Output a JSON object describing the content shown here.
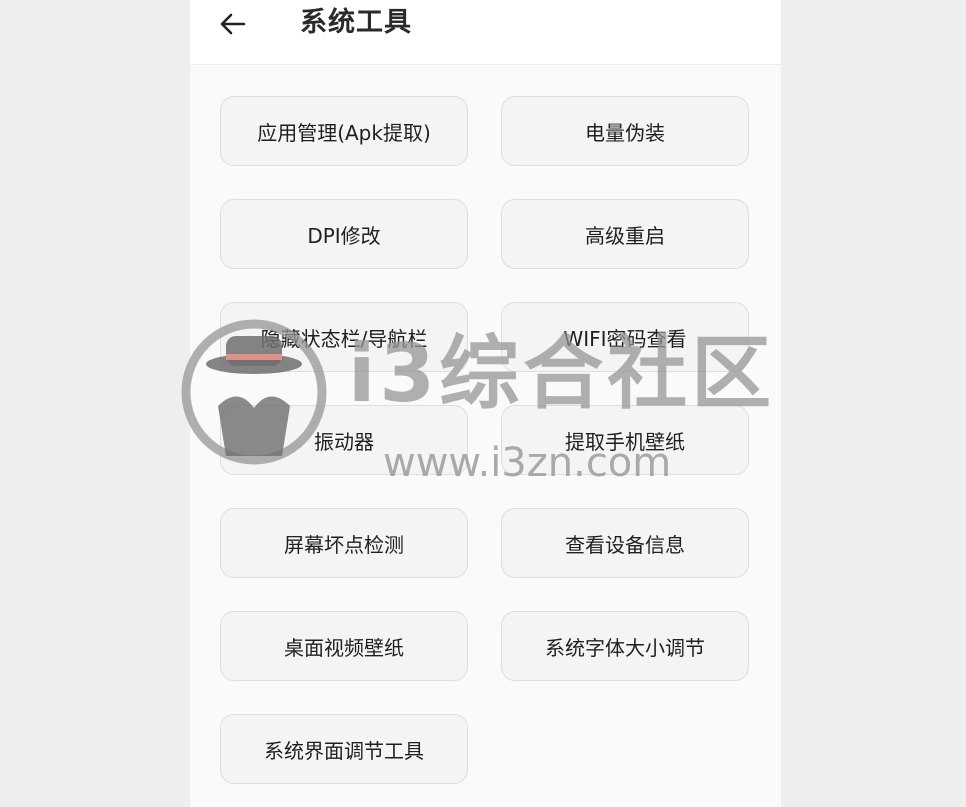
{
  "header": {
    "title": "系统工具",
    "back_icon": "arrow-left-icon"
  },
  "tools": [
    {
      "label": "应用管理(Apk提取)"
    },
    {
      "label": "电量伪装"
    },
    {
      "label": "DPI修改"
    },
    {
      "label": "高级重启"
    },
    {
      "label": "隐藏状态栏/导航栏"
    },
    {
      "label": "WIFI密码查看"
    },
    {
      "label": "振动器"
    },
    {
      "label": "提取手机壁纸"
    },
    {
      "label": "屏幕坏点检测"
    },
    {
      "label": "查看设备信息"
    },
    {
      "label": "桌面视频壁纸"
    },
    {
      "label": "系统字体大小调节"
    },
    {
      "label": "系统界面调节工具"
    }
  ],
  "watermark": {
    "name": "i3综合社区",
    "url": "www.i3zn.com"
  },
  "colors": {
    "background": "#fafafa",
    "button_bg": "#f4f4f4",
    "button_border": "#dedede",
    "text": "#1f1f1f"
  }
}
